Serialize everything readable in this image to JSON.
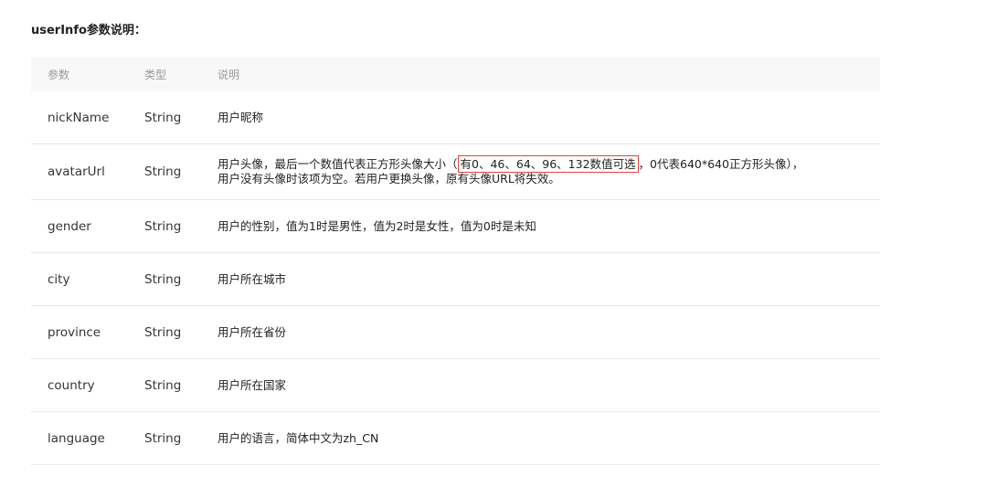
{
  "section_title": "userInfo参数说明：",
  "table": {
    "headers": [
      "参数",
      "类型",
      "说明"
    ],
    "rows": [
      {
        "param": "nickName",
        "type": "String",
        "desc": "用户昵称"
      },
      {
        "param": "avatarUrl",
        "type": "String",
        "desc_pre": "用户头像，最后一个数值代表正方形头像大小（",
        "desc_highlight": "有0、46、64、96、132数值可选",
        "desc_post": "，0代表640*640正方形头像），",
        "desc_line2": "用户没有头像时该项为空。若用户更换头像，原有头像URL将失效。"
      },
      {
        "param": "gender",
        "type": "String",
        "desc": "用户的性别，值为1时是男性，值为2时是女性，值为0时是未知"
      },
      {
        "param": "city",
        "type": "String",
        "desc": "用户所在城市"
      },
      {
        "param": "province",
        "type": "String",
        "desc": "用户所在省份"
      },
      {
        "param": "country",
        "type": "String",
        "desc": "用户所在国家"
      },
      {
        "param": "language",
        "type": "String",
        "desc": "用户的语言，简体中文为zh_CN"
      }
    ]
  },
  "colors": {
    "header_bg": "#f8f8f8",
    "highlight_border": "#e5413d",
    "row_border": "#e8e8e8"
  }
}
